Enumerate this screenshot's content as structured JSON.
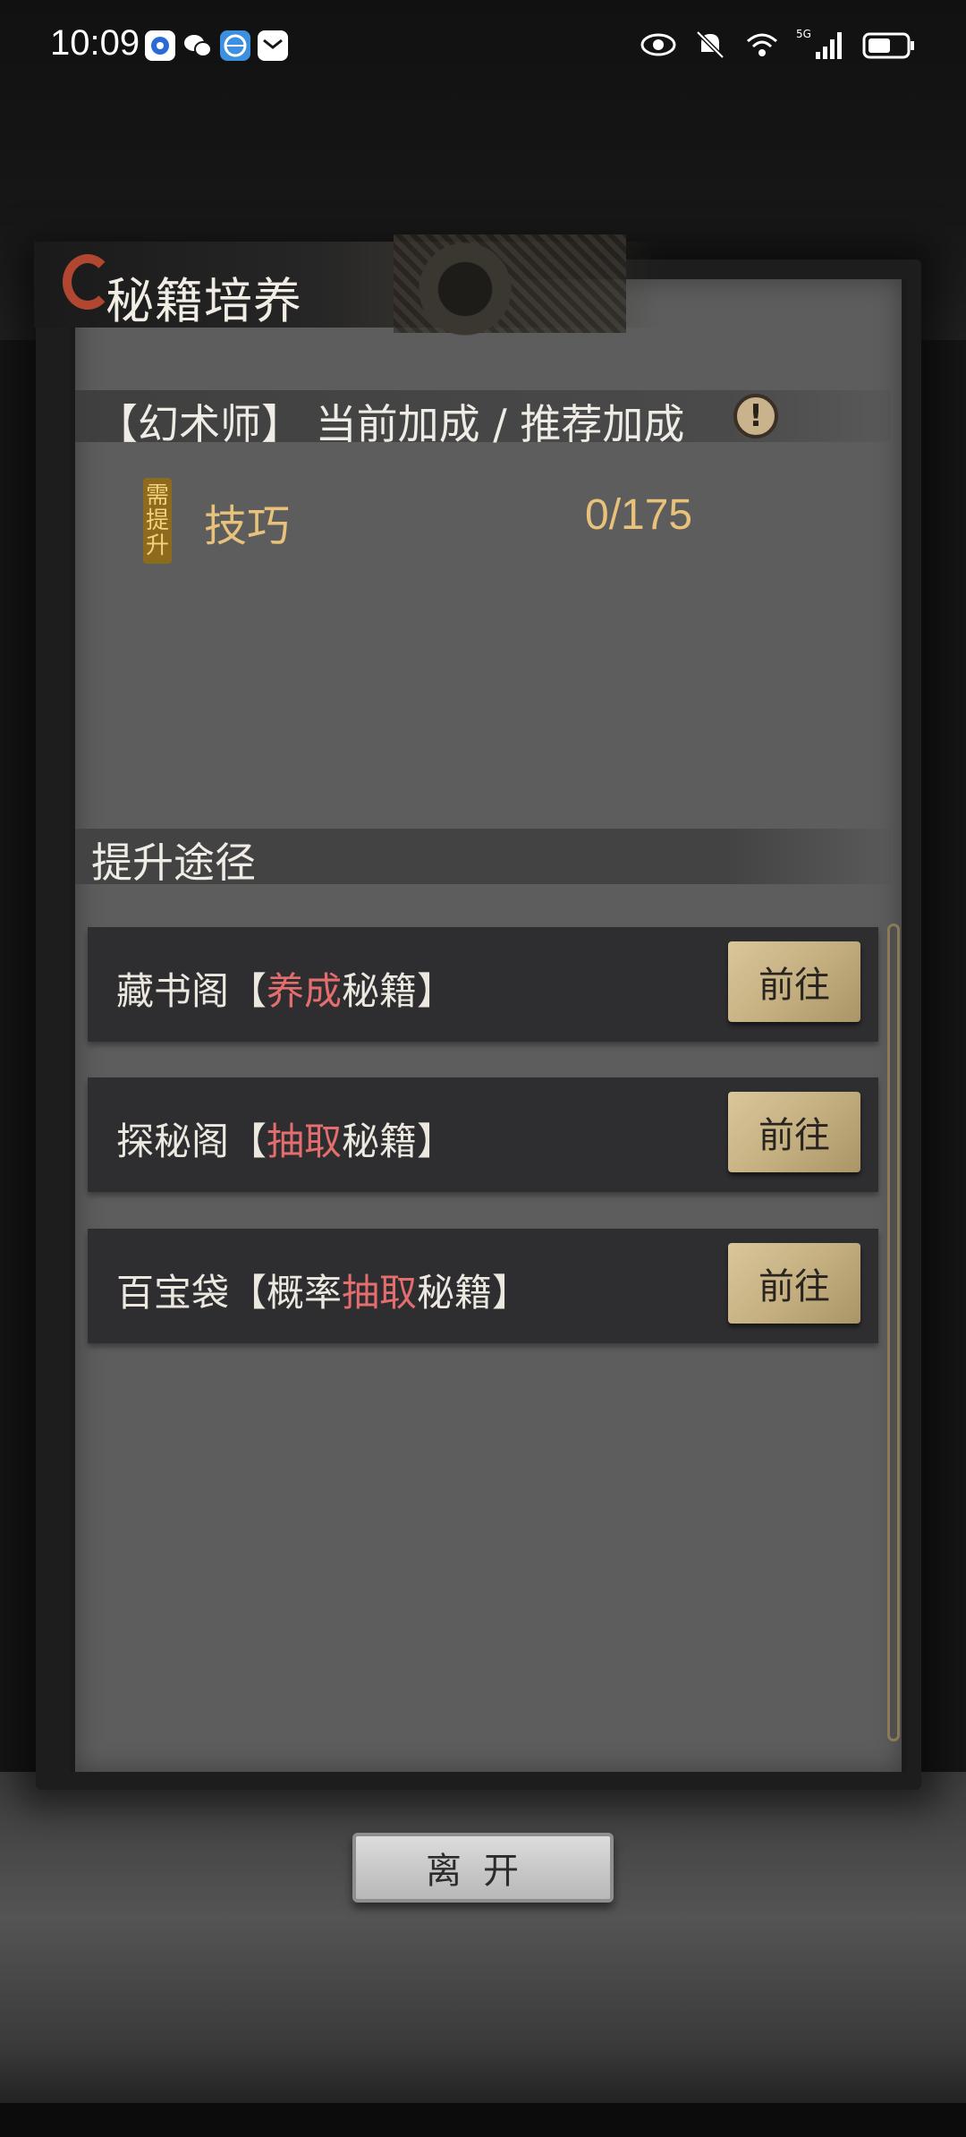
{
  "status_bar": {
    "time": "10:09",
    "notifications": [
      {
        "icon": "app-notification-icon",
        "color": "#2a6bd6"
      },
      {
        "icon": "wechat-icon",
        "color": "#ffffff"
      },
      {
        "icon": "browser-icon",
        "color": "#3d8fe0"
      },
      {
        "icon": "message-icon",
        "color": "#ffffff"
      }
    ],
    "network_label": "5G",
    "icons": [
      "eye-icon",
      "bell-muted-icon",
      "wifi-icon",
      "signal-icon",
      "battery-icon"
    ],
    "battery_level": 0.6
  },
  "panel": {
    "title": "秘籍培养",
    "bonus_header": "【幻术师】 当前加成 / 推荐加成",
    "info_symbol": "!",
    "need_badge": [
      "需",
      "提",
      "升"
    ],
    "stat": {
      "name": "技巧",
      "value": "0/175"
    }
  },
  "routes_section": {
    "title": "提升途径",
    "routes": [
      {
        "prefix": "藏书阁【",
        "highlight": "养成",
        "suffix": "秘籍】",
        "button": "前往"
      },
      {
        "prefix": "探秘阁【",
        "highlight": "抽取",
        "suffix": "秘籍】",
        "button": "前往"
      },
      {
        "prefix": "百宝袋【概率",
        "highlight": "抽取",
        "suffix": "秘籍】",
        "button": "前往"
      }
    ]
  },
  "leave_button": "离开",
  "colors": {
    "highlight": "#e46d6d",
    "stat": "#e8c27a",
    "button": "#c5b081"
  }
}
